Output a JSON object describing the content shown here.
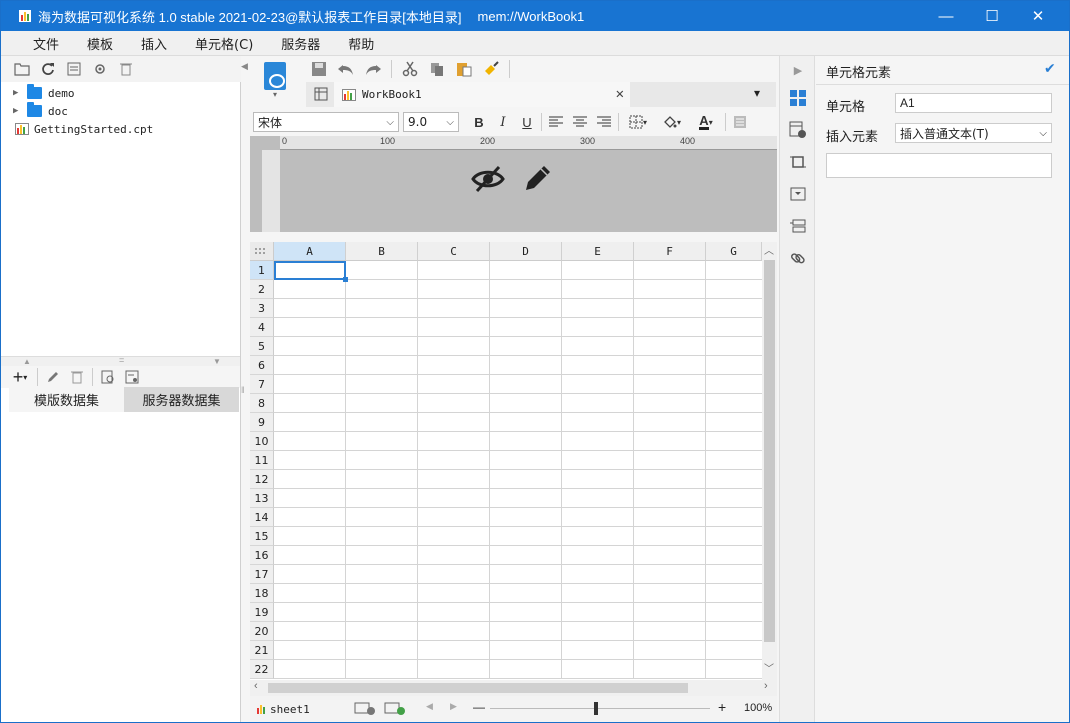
{
  "window": {
    "title": "海为数据可视化系统 1.0 stable 2021-02-23@默认报表工作目录[本地目录]",
    "path": "mem://WorkBook1",
    "minimize": "—",
    "maximize": "☐",
    "close": "✕"
  },
  "menu": [
    "文件",
    "模板",
    "插入",
    "单元格(C)",
    "服务器",
    "帮助"
  ],
  "tree": [
    {
      "label": "demo",
      "type": "folder"
    },
    {
      "label": "doc",
      "type": "folder"
    },
    {
      "label": "GettingStarted.cpt",
      "type": "file"
    }
  ],
  "dataset_tabs": [
    "模版数据集",
    "服务器数据集"
  ],
  "doc_tab": "WorkBook1",
  "format": {
    "font": "宋体",
    "size": "9.0",
    "bold": "B",
    "italic": "I",
    "underline": "U"
  },
  "ruler": [
    "0",
    "100",
    "200",
    "300",
    "400"
  ],
  "columns": [
    "A",
    "B",
    "C",
    "D",
    "E",
    "F",
    "G"
  ],
  "rows": [
    "1",
    "2",
    "3",
    "4",
    "5",
    "6",
    "7",
    "8",
    "9",
    "10",
    "11",
    "12",
    "13",
    "14",
    "15",
    "16",
    "17",
    "18",
    "19",
    "20",
    "21",
    "22"
  ],
  "selected_cell": "A1",
  "sheet": {
    "name": "sheet1",
    "zoom": "100%",
    "minus": "—",
    "plus": "+"
  },
  "properties": {
    "title": "单元格元素",
    "cell_label": "单元格",
    "cell_value": "A1",
    "insert_label": "插入元素",
    "insert_value": "插入普通文本(T)"
  },
  "colors": {
    "titlebar": "#1874d2",
    "accent": "#2a7fd4"
  }
}
